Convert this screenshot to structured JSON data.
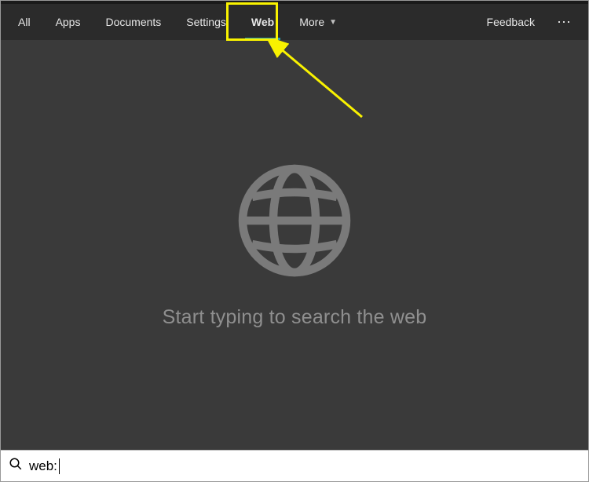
{
  "tabs": {
    "all": "All",
    "apps": "Apps",
    "documents": "Documents",
    "settings": "Settings",
    "web": "Web",
    "more": "More"
  },
  "header": {
    "feedback": "Feedback",
    "ellipsis": "⋯"
  },
  "main": {
    "prompt": "Start typing to search the web"
  },
  "search": {
    "value": "web:"
  }
}
